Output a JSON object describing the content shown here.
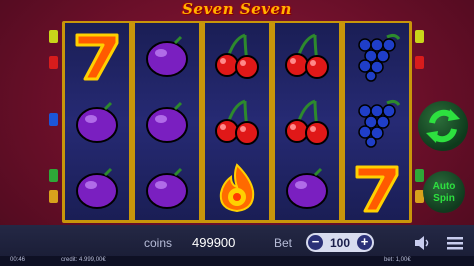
{
  "title": "Seven Seven",
  "reels": [
    [
      "seven",
      "plum",
      "plum"
    ],
    [
      "plum",
      "plum",
      "plum"
    ],
    [
      "cherry",
      "cherry",
      "fireball"
    ],
    [
      "cherry",
      "cherry",
      "plum"
    ],
    [
      "grapes",
      "grapes",
      "seven"
    ]
  ],
  "bottom": {
    "coins_label": "coins",
    "coins_value": "499900",
    "bet_label": "Bet",
    "bet_value": "100",
    "minus_label": "−",
    "plus_label": "+",
    "time": "00:46",
    "credit": "credit: 4.999,00€",
    "bet_money": "bet: 1,00€"
  },
  "controls": {
    "auto_spin_line1": "Auto",
    "auto_spin_line2": "Spin"
  },
  "icons": {
    "spin": "refresh-arrows-icon",
    "sound": "speaker-icon",
    "menu": "menu-icon"
  },
  "colors": {
    "background": "#6b0f2a",
    "reel": "#262a74",
    "frame": "#c8960a",
    "spin_green": "#2de03f",
    "logo": "#ffb300"
  }
}
